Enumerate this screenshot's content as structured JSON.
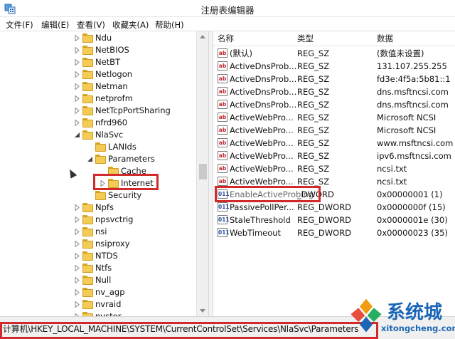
{
  "window": {
    "title": "注册表编辑器"
  },
  "menu": [
    "文件(F)",
    "编辑(E)",
    "查看(V)",
    "收藏夹(A)",
    "帮助(H)"
  ],
  "tree": {
    "items": [
      {
        "label": "Ndu",
        "expander": "collapsed"
      },
      {
        "label": "NetBIOS",
        "expander": "collapsed"
      },
      {
        "label": "NetBT",
        "expander": "collapsed"
      },
      {
        "label": "Netlogon",
        "expander": "collapsed"
      },
      {
        "label": "Netman",
        "expander": "collapsed"
      },
      {
        "label": "netprofm",
        "expander": "collapsed"
      },
      {
        "label": "NetTcpPortSharing",
        "expander": "collapsed"
      },
      {
        "label": "nfrd960",
        "expander": "collapsed"
      },
      {
        "label": "NlaSvc",
        "expander": "expanded"
      },
      {
        "label": "LANIds",
        "expander": "none"
      },
      {
        "label": "Parameters",
        "expander": "expanded"
      },
      {
        "label": "Cache",
        "expander": "none"
      },
      {
        "label": "Internet",
        "expander": "collapsed"
      },
      {
        "label": "Security",
        "expander": "none"
      },
      {
        "label": "Npfs",
        "expander": "collapsed"
      },
      {
        "label": "npsvctrig",
        "expander": "collapsed"
      },
      {
        "label": "nsi",
        "expander": "collapsed"
      },
      {
        "label": "nsiproxy",
        "expander": "collapsed"
      },
      {
        "label": "NTDS",
        "expander": "collapsed"
      },
      {
        "label": "Ntfs",
        "expander": "collapsed"
      },
      {
        "label": "Null",
        "expander": "collapsed"
      },
      {
        "label": "nv_agp",
        "expander": "collapsed"
      },
      {
        "label": "nvraid",
        "expander": "collapsed"
      },
      {
        "label": "nvstor",
        "expander": "collapsed"
      }
    ]
  },
  "list": {
    "headers": {
      "name": "名称",
      "type": "类型",
      "data": "数据"
    },
    "rows": [
      {
        "icon": "ab",
        "name": "(默认)",
        "type": "REG_SZ",
        "data": "(数值未设置)"
      },
      {
        "icon": "ab",
        "name": "ActiveDnsProb...",
        "type": "REG_SZ",
        "data": "131.107.255.255"
      },
      {
        "icon": "ab",
        "name": "ActiveDnsProb...",
        "type": "REG_SZ",
        "data": "fd3e:4f5a:5b81::1"
      },
      {
        "icon": "ab",
        "name": "ActiveDnsProb...",
        "type": "REG_SZ",
        "data": "dns.msftncsi.com"
      },
      {
        "icon": "ab",
        "name": "ActiveDnsProb...",
        "type": "REG_SZ",
        "data": "dns.msftncsi.com"
      },
      {
        "icon": "ab",
        "name": "ActiveWebPro...",
        "type": "REG_SZ",
        "data": "Microsoft NCSI"
      },
      {
        "icon": "ab",
        "name": "ActiveWebPro...",
        "type": "REG_SZ",
        "data": "Microsoft NCSI"
      },
      {
        "icon": "ab",
        "name": "ActiveWebPro...",
        "type": "REG_SZ",
        "data": "www.msftncsi.com"
      },
      {
        "icon": "ab",
        "name": "ActiveWebPro...",
        "type": "REG_SZ",
        "data": "ipv6.msftncsi.com"
      },
      {
        "icon": "ab",
        "name": "ActiveWebPro...",
        "type": "REG_SZ",
        "data": "ncsi.txt"
      },
      {
        "icon": "ab",
        "name": "ActiveWebPro...",
        "type": "REG_SZ",
        "data": "ncsi.txt"
      },
      {
        "icon": "011",
        "name": "EnableActiveProbing",
        "type": "_DWORD",
        "data": "0x00000001 (1)"
      },
      {
        "icon": "011",
        "name": "PassivePollPer...",
        "type": "REG_DWORD",
        "data": "0x0000000f (15)"
      },
      {
        "icon": "011",
        "name": "StaleThreshold",
        "type": "REG_DWORD",
        "data": "0x0000001e (30)"
      },
      {
        "icon": "011",
        "name": "WebTimeout",
        "type": "REG_DWORD",
        "data": "0x00000023 (35)"
      }
    ]
  },
  "status": {
    "path": "计算机\\HKEY_LOCAL_MACHINE\\SYSTEM\\CurrentControlSet\\Services\\NlaSvc\\Parameters"
  },
  "watermark": {
    "main": "系统城",
    "sub": "xitongcheng.com"
  },
  "colors": {
    "highlight": "#d02a2a",
    "folder": "#f3cb55",
    "watermark": "#1b65b5"
  }
}
